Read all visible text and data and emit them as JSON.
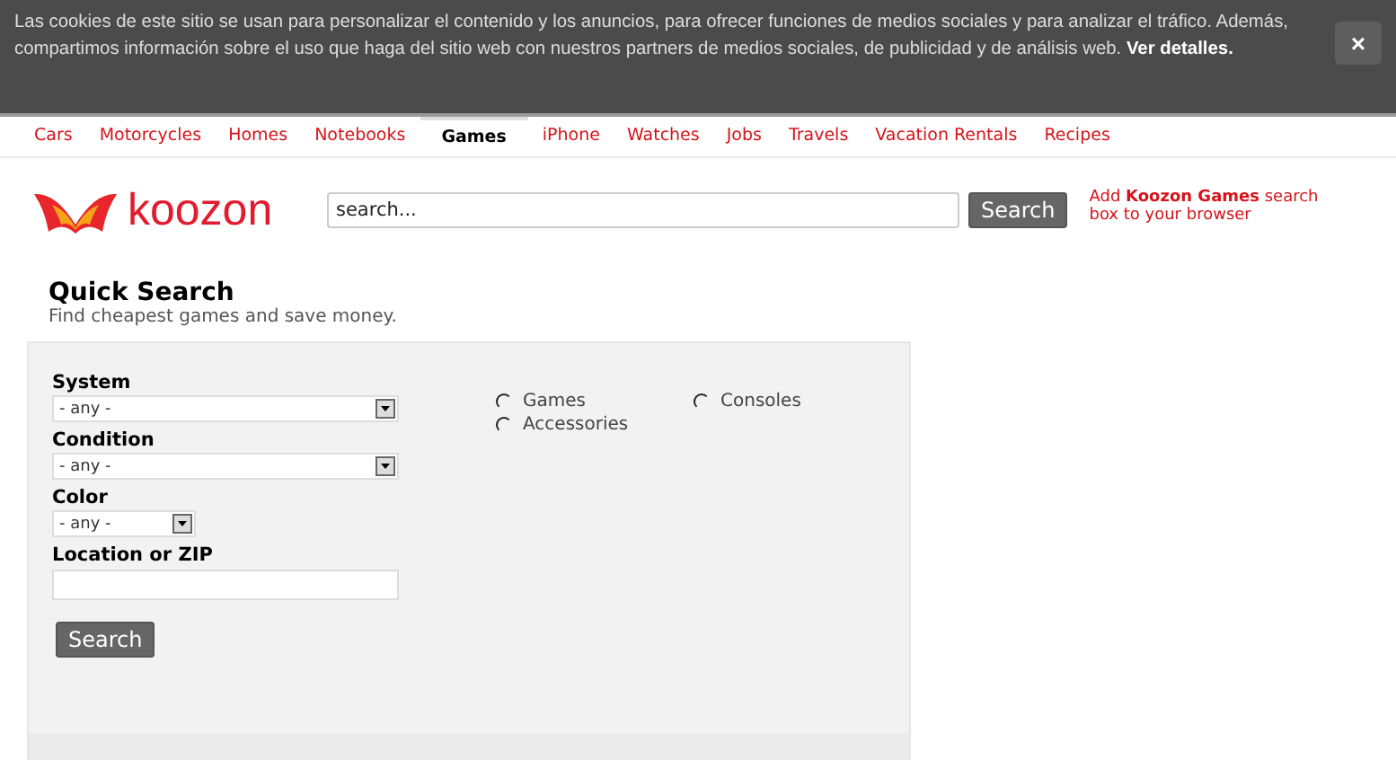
{
  "cookie_banner": {
    "text": "Las cookies de este sitio se usan para personalizar el contenido y los anuncios, para ofrecer funciones de medios sociales y para analizar el tráfico. Además, compartimos información sobre el uso que haga del sitio web con nuestros partners de medios sociales, de publicidad y de análisis web. **Ver detalles.**",
    "close": "×"
  },
  "nav": [
    {
      "label": "Cars",
      "selected": false
    },
    {
      "label": "Motorcycles",
      "selected": false
    },
    {
      "label": "Homes",
      "selected": false
    },
    {
      "label": "Notebooks",
      "selected": false
    },
    {
      "label": "Games",
      "selected": true
    },
    {
      "label": "iPhone",
      "selected": false
    },
    {
      "label": "Watches",
      "selected": false
    },
    {
      "label": "Jobs",
      "selected": false
    },
    {
      "label": "Travels",
      "selected": false
    },
    {
      "label": "Vacation Rentals",
      "selected": false
    },
    {
      "label": "Recipes",
      "selected": false
    }
  ],
  "logo": "koozon",
  "search": {
    "placeholder": "search...",
    "button": "Search"
  },
  "add_link": "Add **Koozon Games** search box to your browser",
  "quick_search": {
    "title": "Quick Search",
    "subtitle": "Find cheapest games and save money.",
    "fields": [
      {
        "label": "System",
        "kind": "select",
        "value": "- any -"
      },
      {
        "label": "Condition",
        "kind": "select",
        "value": "- any -"
      },
      {
        "label": "Color",
        "kind": "short_select",
        "value": "- any -"
      },
      {
        "label": "Location or ZIP",
        "kind": "text"
      }
    ],
    "button": "Search",
    "types": [
      {
        "label": "Games",
        "selected": false
      },
      {
        "label": "Consoles",
        "selected": false
      },
      {
        "label": "Accessories",
        "selected": false
      }
    ]
  }
}
